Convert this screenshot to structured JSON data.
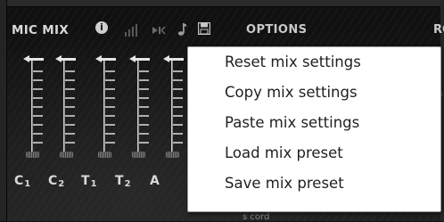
{
  "header": {
    "title": "MIC MIX",
    "info_icon": "i",
    "options_label": "OPTIONS",
    "edge_label": "RO"
  },
  "channels": [
    {
      "base": "C",
      "sub": "1"
    },
    {
      "base": "C",
      "sub": "2"
    },
    {
      "base": "T",
      "sub": "1"
    },
    {
      "base": "T",
      "sub": "2"
    },
    {
      "base": "A",
      "sub": ""
    }
  ],
  "context_menu": {
    "items": [
      "Reset mix settings",
      "Copy mix settings",
      "Paste mix settings",
      "Load mix preset",
      "Save mix preset"
    ]
  },
  "footer": {
    "faint_text": "s cord"
  },
  "icons": {
    "header": [
      "info-icon",
      "level-bars-icon",
      "route-icon",
      "music-note-icon",
      "save-icon"
    ],
    "edge": [
      "wrench-icon",
      "knob-icon"
    ]
  },
  "colors": {
    "background": "#141414",
    "text": "#d8d8d8",
    "menu_bg": "#ffffff",
    "menu_text": "#1f1f1f"
  }
}
